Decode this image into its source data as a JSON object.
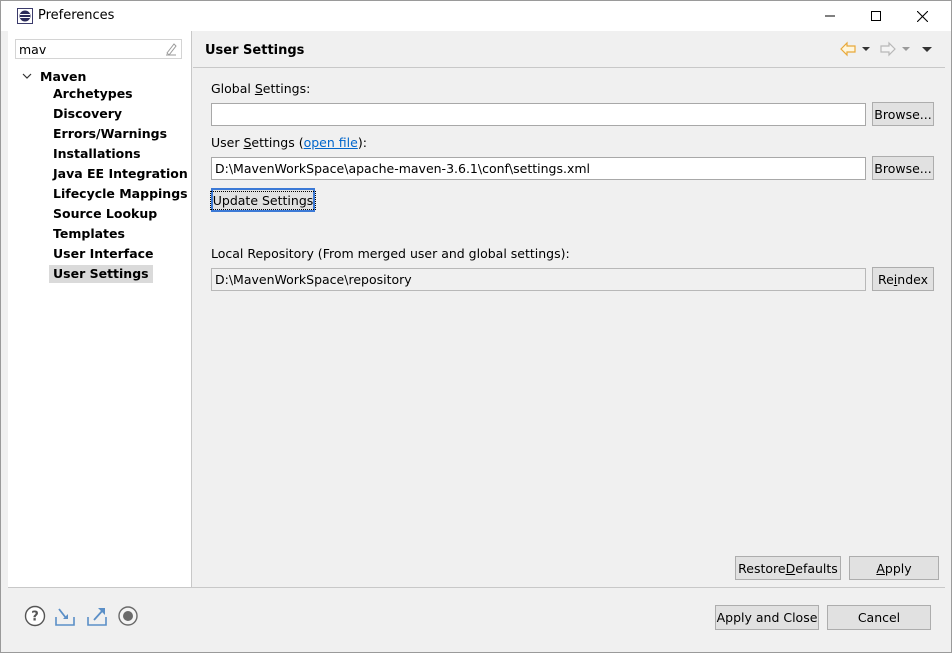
{
  "window": {
    "title": "Preferences"
  },
  "sidebar": {
    "filter_value": "mav",
    "root_label": "Maven",
    "items": [
      {
        "label": "Archetypes"
      },
      {
        "label": "Discovery"
      },
      {
        "label": "Errors/Warnings"
      },
      {
        "label": "Installations"
      },
      {
        "label": "Java EE Integration"
      },
      {
        "label": "Lifecycle Mappings"
      },
      {
        "label": "Source Lookup"
      },
      {
        "label": "Templates"
      },
      {
        "label": "User Interface"
      },
      {
        "label": "User Settings"
      }
    ],
    "selected": "User Settings"
  },
  "page": {
    "title": "User Settings",
    "global_settings_label_pre": "Global ",
    "global_settings_label_u": "S",
    "global_settings_label_post": "ettings:",
    "global_settings_value": "",
    "browse_label": "Browse...",
    "user_settings_label_pre": "User ",
    "user_settings_label_u": "S",
    "user_settings_label_mid": "ettings (",
    "open_file_link": "open file",
    "user_settings_label_post": "):",
    "user_settings_value": "D:\\MavenWorkSpace\\apache-maven-3.6.1\\conf\\settings.xml",
    "update_settings_label": "Update Settings",
    "local_repo_label": "Local Repository (From merged user and global settings):",
    "local_repo_value": "D:\\MavenWorkSpace\\repository",
    "reindex_pre": "Re",
    "reindex_u": "i",
    "reindex_post": "ndex",
    "restore_defaults_pre": "Restore ",
    "restore_defaults_u": "D",
    "restore_defaults_post": "efaults",
    "apply_u": "A",
    "apply_post": "pply"
  },
  "footer": {
    "apply_and_close": "Apply and Close",
    "cancel": "Cancel"
  },
  "icons": {
    "app": "preferences-app-icon",
    "help": "help-icon",
    "import": "import-icon",
    "export": "export-icon",
    "record": "record-icon"
  },
  "colors": {
    "link": "#0066cc",
    "selection": "#dadada",
    "focus": "#3b79d6",
    "nav_arrow": "#e8a838"
  }
}
